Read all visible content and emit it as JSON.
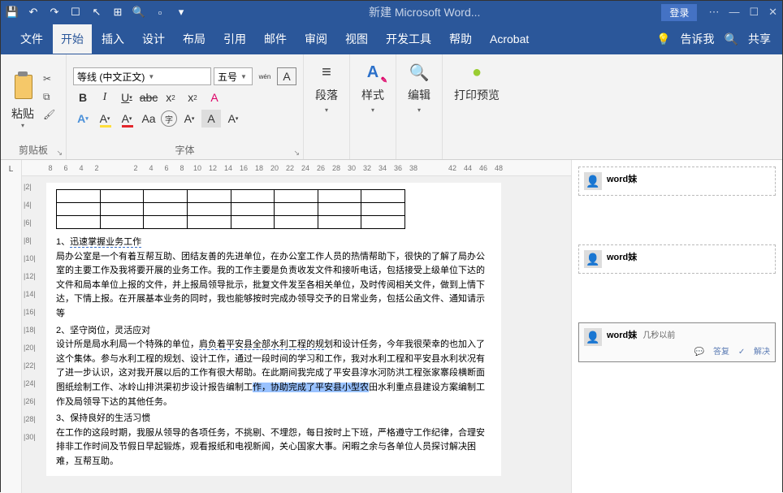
{
  "titlebar": {
    "title": "新建 Microsoft Word...",
    "login": "登录"
  },
  "menu": {
    "file": "文件",
    "home": "开始",
    "insert": "插入",
    "design": "设计",
    "layout": "布局",
    "references": "引用",
    "mail": "邮件",
    "review": "审阅",
    "view": "视图",
    "dev": "开发工具",
    "help": "帮助",
    "acrobat": "Acrobat",
    "tellme": "告诉我",
    "share": "共享"
  },
  "ribbon": {
    "clipboard": {
      "label": "剪贴板",
      "paste": "粘贴"
    },
    "font": {
      "label": "字体",
      "name": "等线 (中文正文)",
      "size": "五号",
      "wen": "wén",
      "bold": "B",
      "italic": "I",
      "underline": "U",
      "strike": "abc",
      "sub": "x",
      "sup": "x",
      "clear_icon": "A",
      "ruby": "A",
      "border": "A",
      "hilite": "A",
      "grow": "Aa",
      "enclose": "字",
      "color": "A",
      "shade": "A",
      "change": "A"
    },
    "paragraph": {
      "label": "段落"
    },
    "styles": {
      "label": "样式",
      "icon": "A"
    },
    "editing": {
      "label": "编辑"
    },
    "print_preview": {
      "label": "打印预览"
    }
  },
  "doc": {
    "item1_num": "1、",
    "item1_title": "迅速掌握业务工作",
    "p1": "局办公室是一个有着互帮互助、团结友善的先进单位，在办公室工作人员的热情帮助下，很快的了解了局办公室的主要工作及我将要开展的业务工作。我的工作主要是负责收发文件和接听电话，包括接受上级单位下达的文件和局本单位上报的文件，并上报局领导批示，批复文件发至各相关单位，及时传阅相关文件，做到上情下达，下情上报。在开展基本业务的同时，我也能够按时完成办领导交予的日常业务，包括公函文件、通知请示等",
    "item2_num": "2、",
    "item2_title": "坚守岗位，灵活应对",
    "p2a": "设计所是局水利局一个特殊的单位，",
    "p2_hl": "肩负着平安县全部水利工程的规",
    "p2b": "划和设计任务，今年我很荣幸的也加入了这个集体。参与水利工程的规划、设计工作，通过一段时间的学习和工作，我对水利工程和平安县水利状况有了进一步认识，这对我开展以后的工作有很大帮助。在此期间我完成了平安县淳水河防洪工程张家寨段横断面图纸绘制工作、冰岭山排洪渠初步设计报告编制工",
    "p2_sel": "作，协助完成了平安县小型农",
    "p2c": "田水利重点县建设方案编制工作及局领导下达的其他任务。",
    "item3_num": "3、",
    "item3_title": "保持良好的生活习惯",
    "p3": "在工作的这段时期，我服从领导的各项任务，不挑剔、不埋怨，每日按时上下班，严格遵守工作纪律，合理安排非工作时间及节假日早起锻炼，观看报纸和电视新闻，关心国家大事。闲暇之余与各单位人员探讨解决困难，互帮互助。"
  },
  "comments": {
    "author": "word妹",
    "time": "几秒以前",
    "reply": "答复",
    "resolve": "解决"
  },
  "ruler": {
    "h": [
      "8",
      "6",
      "4",
      "2",
      "",
      "2",
      "4",
      "6",
      "8",
      "10",
      "12",
      "14",
      "16",
      "18",
      "20",
      "22",
      "24",
      "26",
      "28",
      "30",
      "32",
      "34",
      "36",
      "38",
      "",
      "42",
      "44",
      "46",
      "48"
    ],
    "v": [
      "|2|",
      "|4|",
      "|6|",
      "|8|",
      "|10|",
      "|12|",
      "|14|",
      "|16|",
      "|18|",
      "|20|",
      "|22|",
      "|24|",
      "|26|",
      "|28|",
      "|30|"
    ]
  }
}
